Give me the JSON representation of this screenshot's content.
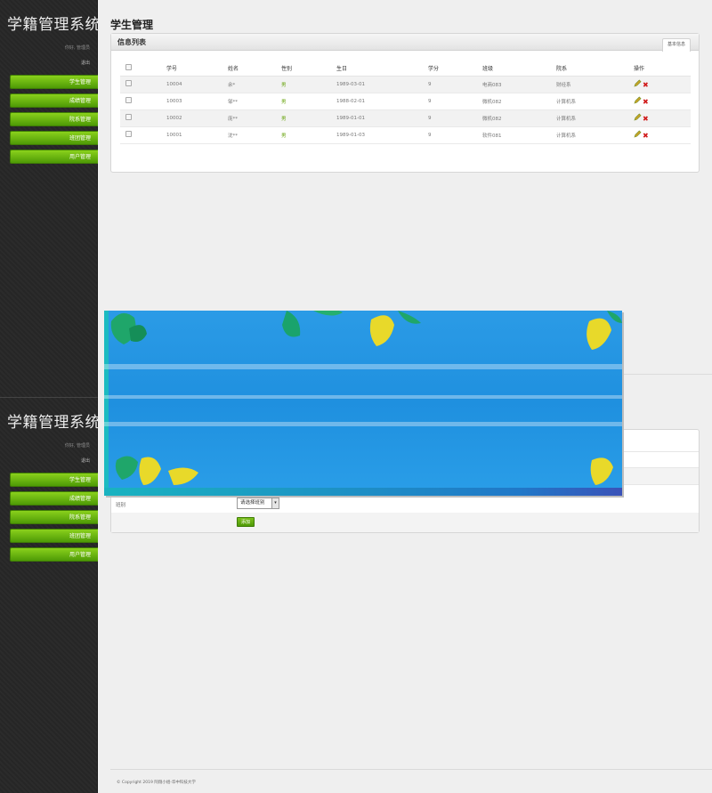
{
  "app": {
    "title": "学籍管理系统",
    "greeting": "你好, 管理员",
    "logout": "退出",
    "nav": [
      "学生管理",
      "成绩管理",
      "院系管理",
      "班团管理",
      "用户管理"
    ]
  },
  "page": {
    "title": "学生管理"
  },
  "list_panel": {
    "title": "信息列表",
    "tab": "基本信息",
    "columns": [
      "学号",
      "姓名",
      "性别",
      "生日",
      "学分",
      "班级",
      "院系",
      "操作"
    ],
    "rows": [
      [
        "10004",
        "余*",
        "男",
        "1989-03-01",
        "9",
        "电商083",
        "财经系"
      ],
      [
        "10003",
        "邹**",
        "男",
        "1988-02-01",
        "9",
        "微机082",
        "计算机系"
      ],
      [
        "10002",
        "庞**",
        "男",
        "1989-01-01",
        "9",
        "微机082",
        "计算机系"
      ],
      [
        "10001",
        "沈**",
        "男",
        "1989-01-03",
        "9",
        "软件081",
        "计算机系"
      ]
    ]
  },
  "form_panel": {
    "class_label": "班别",
    "class_select": "请选择班别",
    "add_button": "添加"
  },
  "footer": "© Copyright 2019 阿翔小组-华中科技大学",
  "colors": {
    "nav_green": "#6ab514",
    "delete_red": "#d01a1a",
    "popup_blue": "#2196e3"
  }
}
